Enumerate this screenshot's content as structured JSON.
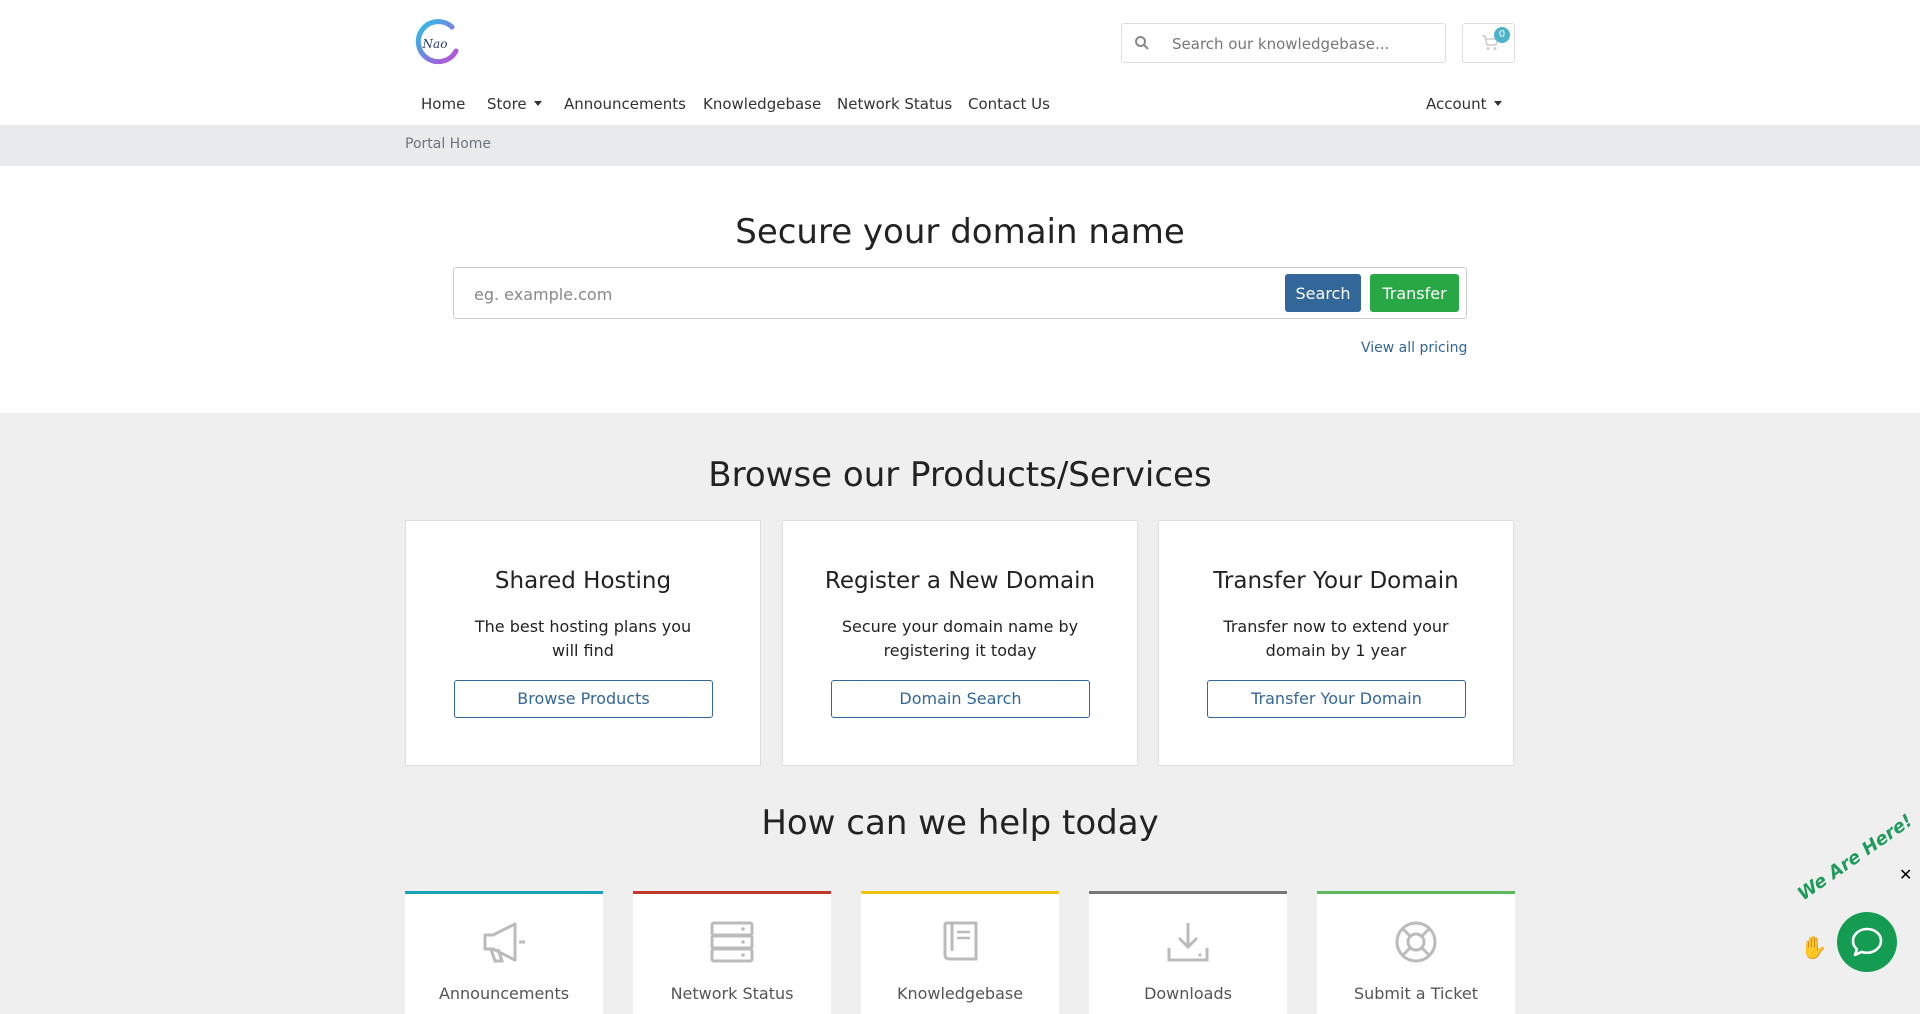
{
  "header": {
    "logo_text": "Nao",
    "kb_search_placeholder": "Search our knowledgebase...",
    "cart_count": "0"
  },
  "nav": {
    "home": "Home",
    "store": "Store",
    "announcements": "Announcements",
    "knowledgebase": "Knowledgebase",
    "network_status": "Network Status",
    "contact_us": "Contact Us",
    "account": "Account"
  },
  "breadcrumb": {
    "current": "Portal Home"
  },
  "hero": {
    "title": "Secure your domain name",
    "input_placeholder": "eg. example.com",
    "search_label": "Search",
    "transfer_label": "Transfer",
    "view_pricing": "View all pricing"
  },
  "products": {
    "title": "Browse our Products/Services",
    "cards": [
      {
        "title": "Shared Hosting",
        "text": "The best hosting plans you will find",
        "button": "Browse Products"
      },
      {
        "title": "Register a New Domain",
        "text": "Secure your domain name by registering it today",
        "button": "Domain Search"
      },
      {
        "title": "Transfer Your Domain",
        "text": "Transfer now to extend your domain by 1 year",
        "button": "Transfer Your Domain"
      }
    ]
  },
  "help": {
    "title": "How can we help today",
    "tiles": [
      {
        "label": "Announcements",
        "icon": "megaphone-icon",
        "color": "#17a2b8"
      },
      {
        "label": "Network Status",
        "icon": "server-icon",
        "color": "#c0392b"
      },
      {
        "label": "Knowledgebase",
        "icon": "book-icon",
        "color": "#f1c40f"
      },
      {
        "label": "Downloads",
        "icon": "download-icon",
        "color": "#777777"
      },
      {
        "label": "Submit a Ticket",
        "icon": "lifebuoy-icon",
        "color": "#5cb85c"
      }
    ]
  },
  "chat": {
    "tagline": "We Are Here!",
    "close": "✕"
  },
  "colors": {
    "primary": "#336699",
    "success": "#28a745",
    "chat_green": "#139c52"
  }
}
